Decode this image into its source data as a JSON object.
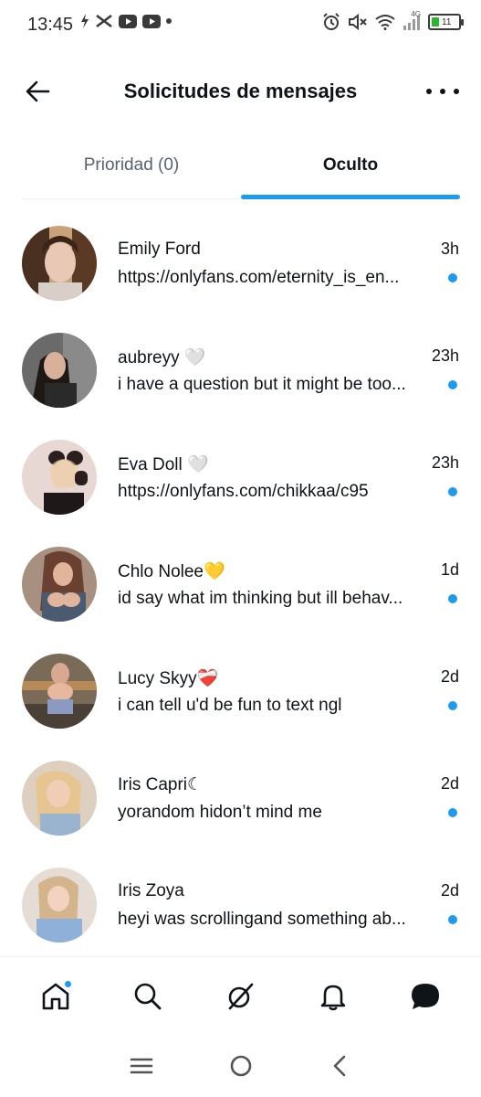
{
  "status_bar": {
    "time": "13:45",
    "network": "4G",
    "battery": "11"
  },
  "header": {
    "title": "Solicitudes de mensajes"
  },
  "tabs": [
    {
      "label": "Prioridad (0)",
      "active": false
    },
    {
      "label": "Oculto",
      "active": true
    }
  ],
  "conversations": [
    {
      "name": "Emily Ford",
      "time": "3h",
      "message": "https://onlyfans.com/eternity_is_en...",
      "unread": true,
      "avatar_color": "#8a6a55"
    },
    {
      "name": "aubreyy 🤍",
      "time": "23h",
      "message": "i have a question but it might be too...",
      "unread": true,
      "avatar_color": "#3a2a28"
    },
    {
      "name": "Eva Doll 🤍",
      "time": "23h",
      "message": "https://onlyfans.com/chikkaa/c95",
      "unread": true,
      "avatar_color": "#d9b9b0"
    },
    {
      "name": "Chlo Nolee💛",
      "time": "1d",
      "message": "id say what im thinking but ill behav...",
      "unread": true,
      "avatar_color": "#b07a60"
    },
    {
      "name": "Lucy Skyy❤️‍🩹",
      "time": "2d",
      "message": "i can tell u'd be fun to text ngl",
      "unread": true,
      "avatar_color": "#5a4a40"
    },
    {
      "name": "Iris Capri☾",
      "time": "2d",
      "message": "yorandom hidon’t mind me",
      "unread": true,
      "avatar_color": "#c9a98a"
    },
    {
      "name": "Iris Zoya",
      "time": "2d",
      "message": "heyi was scrollingand something ab...",
      "unread": true,
      "avatar_color": "#d8c0a8"
    }
  ],
  "colors": {
    "accent": "#1d9bf0",
    "text": "#0f1419",
    "secondary": "#536471"
  },
  "bottom_nav": [
    "home-icon",
    "search-icon",
    "grok-icon",
    "bell-icon",
    "messages-icon"
  ],
  "system_nav": [
    "recent-apps-icon",
    "home-circle-icon",
    "back-chevron-icon"
  ]
}
